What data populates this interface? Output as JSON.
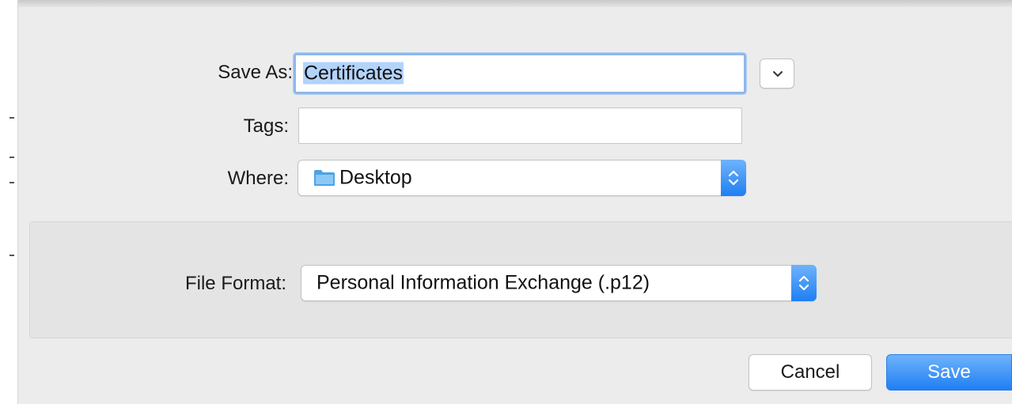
{
  "dialog": {
    "save_as": {
      "label": "Save As:",
      "value": "Certificates"
    },
    "tags": {
      "label": "Tags:",
      "value": ""
    },
    "where": {
      "label": "Where:",
      "value": "Desktop"
    },
    "file_format": {
      "label": "File Format:",
      "value": "Personal Information Exchange (.p12)"
    },
    "buttons": {
      "cancel": "Cancel",
      "save": "Save"
    }
  },
  "colors": {
    "accent": "#1f7ff3",
    "focus_ring": "#8fb7ec",
    "selection": "#b3d3fb",
    "sheet_background": "#ececec",
    "folder": "#4aa3e8"
  },
  "icons": {
    "expand": "chevron-down-icon",
    "popup": "up-down-arrows-icon",
    "location": "folder-icon"
  }
}
